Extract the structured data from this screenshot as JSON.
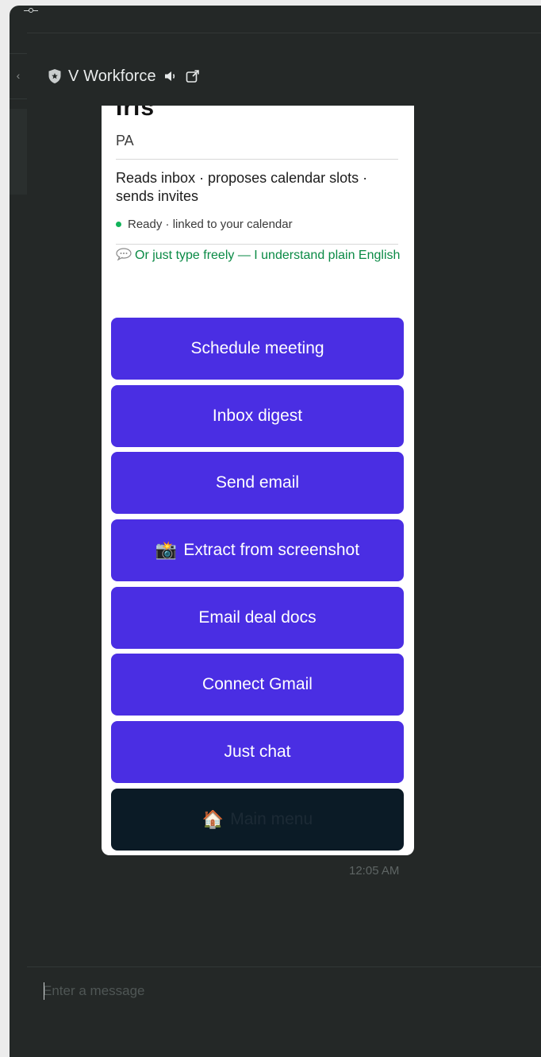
{
  "header": {
    "bot_name": "V Workforce",
    "collapse_glyph": "‹",
    "icons": [
      "shield-icon",
      "speaker-icon",
      "external-link-icon"
    ]
  },
  "card": {
    "cut_title": "Iris",
    "subtitle": "PA",
    "description": "Reads inbox · proposes calendar slots · sends invites",
    "status_text": "Ready · linked to your calendar",
    "hint_text": "Or just type freely — I understand plain English",
    "buttons": [
      {
        "label": "Schedule meeting",
        "emoji": ""
      },
      {
        "label": "Inbox digest",
        "emoji": ""
      },
      {
        "label": "Send email",
        "emoji": ""
      },
      {
        "label": "Extract from screenshot",
        "emoji": "📸"
      },
      {
        "label": "Email deal docs",
        "emoji": ""
      },
      {
        "label": "Connect Gmail",
        "emoji": ""
      },
      {
        "label": "Just chat",
        "emoji": ""
      },
      {
        "label": "Main menu",
        "emoji": "🏠"
      }
    ]
  },
  "message": {
    "timestamp": "12:05 AM"
  },
  "composer": {
    "placeholder": "Enter a message",
    "value": ""
  },
  "colors": {
    "window_bg": "#242827",
    "button_bg": "#4a2ee3",
    "menu_button_bg": "#0b1b26",
    "status_green": "#12b35a",
    "hint_green": "#0a8a45"
  }
}
